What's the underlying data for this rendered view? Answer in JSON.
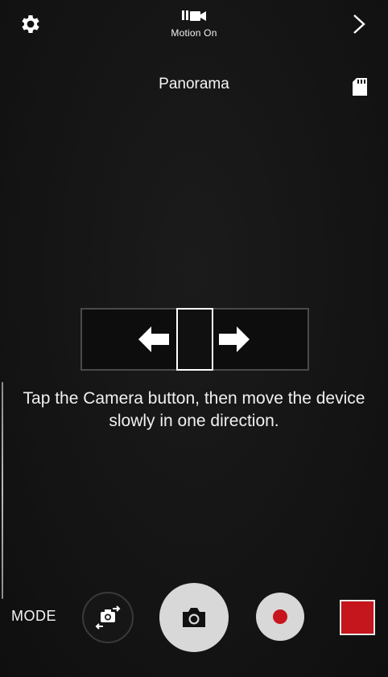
{
  "top_bar": {
    "settings_icon": "gear-icon",
    "motion": {
      "icon": "motion-photo-icon",
      "label": "Motion On"
    },
    "expand_icon": "chevron-right-icon"
  },
  "mode_title": "Panorama",
  "storage_icon": "sd-card-icon",
  "panorama_guide": {
    "left_arrow": "arrow-left-icon",
    "right_arrow": "arrow-right-icon"
  },
  "instruction": "Tap the Camera button, then move the device slowly in one direction.",
  "bottom_bar": {
    "mode_label": "MODE",
    "switch_camera_icon": "switch-camera-icon",
    "shutter_icon": "camera-icon",
    "record_icon": "record-icon",
    "gallery_thumb_color": "#c4161c"
  },
  "colors": {
    "background": "#141414",
    "record_red": "#c8141c",
    "button_light": "#d8d8d8"
  }
}
